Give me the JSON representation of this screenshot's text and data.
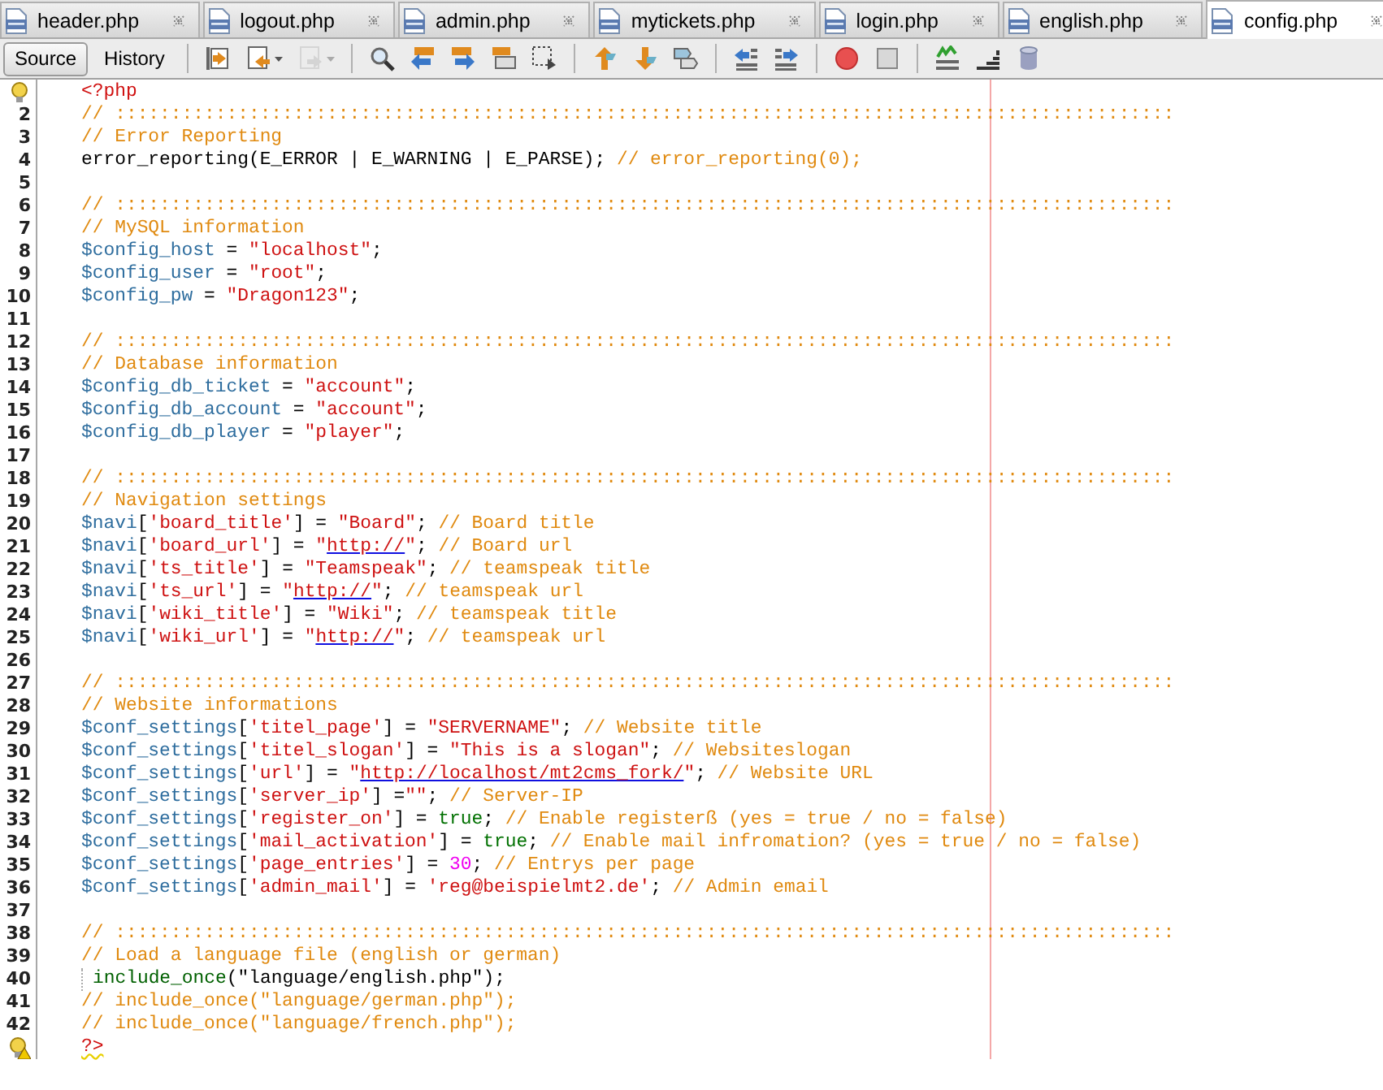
{
  "tabs": [
    {
      "label": "header.php",
      "selected": false
    },
    {
      "label": "logout.php",
      "selected": false
    },
    {
      "label": "admin.php",
      "selected": false
    },
    {
      "label": "mytickets.php",
      "selected": false
    },
    {
      "label": "login.php",
      "selected": false
    },
    {
      "label": "english.php",
      "selected": false
    },
    {
      "label": "config.php",
      "selected": true
    }
  ],
  "view_buttons": [
    {
      "label": "Source",
      "selected": true
    },
    {
      "label": "History",
      "selected": false
    }
  ],
  "toolbar": {
    "buttons": [
      {
        "disabled": false
      },
      {
        "disabled": false
      },
      {
        "disabled": true
      },
      {
        "disabled": false
      },
      {
        "disabled": false
      },
      {
        "disabled": false
      },
      {
        "disabled": false
      },
      {
        "disabled": false
      },
      {
        "disabled": false
      },
      {
        "disabled": false
      },
      {
        "disabled": false
      },
      {
        "disabled": false
      },
      {
        "disabled": false
      },
      {
        "disabled": false
      },
      {
        "disabled": false
      },
      {
        "disabled": false
      },
      {
        "disabled": false
      },
      {
        "disabled": false
      }
    ]
  },
  "editor": {
    "lines": [
      {
        "kind": "hint",
        "tokens": [
          {
            "kind": "tag",
            "text": "<?php"
          }
        ]
      },
      {
        "number": "2",
        "tokens": [
          {
            "kind": "comment",
            "text": "// :::::::::::::::::::::::::::::::::::::::::::::::::::::::::::::::::::::::::::::::::::::::::::::::"
          }
        ]
      },
      {
        "number": "3",
        "tokens": [
          {
            "kind": "comment",
            "text": "// Error Reporting"
          }
        ]
      },
      {
        "number": "4",
        "tokens": [
          {
            "kind": "plain",
            "text": "error_reporting(E_ERROR | E_WARNING | E_PARSE); "
          },
          {
            "kind": "comment",
            "text": "// error_reporting(0);"
          }
        ]
      },
      {
        "number": "5"
      },
      {
        "number": "6",
        "tokens": [
          {
            "kind": "comment",
            "text": "// :::::::::::::::::::::::::::::::::::::::::::::::::::::::::::::::::::::::::::::::::::::::::::::::"
          }
        ]
      },
      {
        "number": "7",
        "tokens": [
          {
            "kind": "comment",
            "text": "// MySQL information"
          }
        ]
      },
      {
        "number": "8",
        "tokens": [
          {
            "kind": "var",
            "text": "$config_host"
          },
          {
            "kind": "plain",
            "text": " = "
          },
          {
            "kind": "str",
            "text": "\"localhost\""
          },
          {
            "kind": "plain",
            "text": ";"
          }
        ]
      },
      {
        "number": "9",
        "tokens": [
          {
            "kind": "var",
            "text": "$config_user"
          },
          {
            "kind": "plain",
            "text": " = "
          },
          {
            "kind": "str",
            "text": "\"root\""
          },
          {
            "kind": "plain",
            "text": ";"
          }
        ]
      },
      {
        "number": "10",
        "tokens": [
          {
            "kind": "var",
            "text": "$config_pw"
          },
          {
            "kind": "plain",
            "text": " = "
          },
          {
            "kind": "str",
            "text": "\"Dragon123\""
          },
          {
            "kind": "plain",
            "text": ";"
          }
        ]
      },
      {
        "number": "11"
      },
      {
        "number": "12",
        "tokens": [
          {
            "kind": "comment",
            "text": "// :::::::::::::::::::::::::::::::::::::::::::::::::::::::::::::::::::::::::::::::::::::::::::::::"
          }
        ]
      },
      {
        "number": "13",
        "tokens": [
          {
            "kind": "comment",
            "text": "// Database information"
          }
        ]
      },
      {
        "number": "14",
        "tokens": [
          {
            "kind": "var",
            "text": "$config_db_ticket"
          },
          {
            "kind": "plain",
            "text": " = "
          },
          {
            "kind": "str",
            "text": "\"account\""
          },
          {
            "kind": "plain",
            "text": ";"
          }
        ]
      },
      {
        "number": "15",
        "tokens": [
          {
            "kind": "var",
            "text": "$config_db_account"
          },
          {
            "kind": "plain",
            "text": " = "
          },
          {
            "kind": "str",
            "text": "\"account\""
          },
          {
            "kind": "plain",
            "text": ";"
          }
        ]
      },
      {
        "number": "16",
        "tokens": [
          {
            "kind": "var",
            "text": "$config_db_player"
          },
          {
            "kind": "plain",
            "text": " = "
          },
          {
            "kind": "str",
            "text": "\"player\""
          },
          {
            "kind": "plain",
            "text": ";"
          }
        ]
      },
      {
        "number": "17"
      },
      {
        "number": "18",
        "tokens": [
          {
            "kind": "comment",
            "text": "// :::::::::::::::::::::::::::::::::::::::::::::::::::::::::::::::::::::::::::::::::::::::::::::::"
          }
        ]
      },
      {
        "number": "19",
        "tokens": [
          {
            "kind": "comment",
            "text": "// Navigation settings"
          }
        ]
      },
      {
        "number": "20",
        "tokens": [
          {
            "kind": "var",
            "text": "$navi"
          },
          {
            "kind": "plain",
            "text": "["
          },
          {
            "kind": "str",
            "text": "'board_title'"
          },
          {
            "kind": "plain",
            "text": "] = "
          },
          {
            "kind": "str",
            "text": "\"Board\""
          },
          {
            "kind": "plain",
            "text": "; "
          },
          {
            "kind": "comment",
            "text": "// Board title"
          }
        ]
      },
      {
        "number": "21",
        "tokens": [
          {
            "kind": "var",
            "text": "$navi"
          },
          {
            "kind": "plain",
            "text": "["
          },
          {
            "kind": "str",
            "text": "'board_url'"
          },
          {
            "kind": "plain",
            "text": "] = "
          },
          {
            "kind": "str",
            "text": "\""
          },
          {
            "kind": "url",
            "text": "http://"
          },
          {
            "kind": "str",
            "text": "\""
          },
          {
            "kind": "plain",
            "text": "; "
          },
          {
            "kind": "comment",
            "text": "// Board url"
          }
        ]
      },
      {
        "number": "22",
        "tokens": [
          {
            "kind": "var",
            "text": "$navi"
          },
          {
            "kind": "plain",
            "text": "["
          },
          {
            "kind": "str",
            "text": "'ts_title'"
          },
          {
            "kind": "plain",
            "text": "] = "
          },
          {
            "kind": "str",
            "text": "\"Teamspeak\""
          },
          {
            "kind": "plain",
            "text": "; "
          },
          {
            "kind": "comment",
            "text": "// teamspeak title"
          }
        ]
      },
      {
        "number": "23",
        "tokens": [
          {
            "kind": "var",
            "text": "$navi"
          },
          {
            "kind": "plain",
            "text": "["
          },
          {
            "kind": "str",
            "text": "'ts_url'"
          },
          {
            "kind": "plain",
            "text": "] = "
          },
          {
            "kind": "str",
            "text": "\""
          },
          {
            "kind": "url",
            "text": "http://"
          },
          {
            "kind": "str",
            "text": "\""
          },
          {
            "kind": "plain",
            "text": "; "
          },
          {
            "kind": "comment",
            "text": "// teamspeak url"
          }
        ]
      },
      {
        "number": "24",
        "tokens": [
          {
            "kind": "var",
            "text": "$navi"
          },
          {
            "kind": "plain",
            "text": "["
          },
          {
            "kind": "str",
            "text": "'wiki_title'"
          },
          {
            "kind": "plain",
            "text": "] = "
          },
          {
            "kind": "str",
            "text": "\"Wiki\""
          },
          {
            "kind": "plain",
            "text": "; "
          },
          {
            "kind": "comment",
            "text": "// teamspeak title"
          }
        ]
      },
      {
        "number": "25",
        "tokens": [
          {
            "kind": "var",
            "text": "$navi"
          },
          {
            "kind": "plain",
            "text": "["
          },
          {
            "kind": "str",
            "text": "'wiki_url'"
          },
          {
            "kind": "plain",
            "text": "] = "
          },
          {
            "kind": "str",
            "text": "\""
          },
          {
            "kind": "url",
            "text": "http://"
          },
          {
            "kind": "str",
            "text": "\""
          },
          {
            "kind": "plain",
            "text": "; "
          },
          {
            "kind": "comment",
            "text": "// teamspeak url"
          }
        ]
      },
      {
        "number": "26"
      },
      {
        "number": "27",
        "tokens": [
          {
            "kind": "comment",
            "text": "// :::::::::::::::::::::::::::::::::::::::::::::::::::::::::::::::::::::::::::::::::::::::::::::::"
          }
        ]
      },
      {
        "number": "28",
        "tokens": [
          {
            "kind": "comment",
            "text": "// Website informations"
          }
        ]
      },
      {
        "number": "29",
        "tokens": [
          {
            "kind": "var",
            "text": "$conf_settings"
          },
          {
            "kind": "plain",
            "text": "["
          },
          {
            "kind": "str",
            "text": "'titel_page'"
          },
          {
            "kind": "plain",
            "text": "] = "
          },
          {
            "kind": "str",
            "text": "\"SERVERNAME\""
          },
          {
            "kind": "plain",
            "text": "; "
          },
          {
            "kind": "comment",
            "text": "// Website title"
          }
        ]
      },
      {
        "number": "30",
        "tokens": [
          {
            "kind": "var",
            "text": "$conf_settings"
          },
          {
            "kind": "plain",
            "text": "["
          },
          {
            "kind": "str",
            "text": "'titel_slogan'"
          },
          {
            "kind": "plain",
            "text": "] = "
          },
          {
            "kind": "str",
            "text": "\"This is a slogan\""
          },
          {
            "kind": "plain",
            "text": "; "
          },
          {
            "kind": "comment",
            "text": "// Websiteslogan"
          }
        ]
      },
      {
        "number": "31",
        "tokens": [
          {
            "kind": "var",
            "text": "$conf_settings"
          },
          {
            "kind": "plain",
            "text": "["
          },
          {
            "kind": "str",
            "text": "'url'"
          },
          {
            "kind": "plain",
            "text": "] = "
          },
          {
            "kind": "str",
            "text": "\""
          },
          {
            "kind": "url",
            "text": "http://localhost/mt2cms_fork/"
          },
          {
            "kind": "str",
            "text": "\""
          },
          {
            "kind": "plain",
            "text": "; "
          },
          {
            "kind": "comment",
            "text": "// Website URL"
          }
        ]
      },
      {
        "number": "32",
        "tokens": [
          {
            "kind": "var",
            "text": "$conf_settings"
          },
          {
            "kind": "plain",
            "text": "["
          },
          {
            "kind": "str",
            "text": "'server_ip'"
          },
          {
            "kind": "plain",
            "text": "] ="
          },
          {
            "kind": "str",
            "text": "\"\""
          },
          {
            "kind": "plain",
            "text": "; "
          },
          {
            "kind": "comment",
            "text": "// Server-IP"
          }
        ]
      },
      {
        "number": "33",
        "tokens": [
          {
            "kind": "var",
            "text": "$conf_settings"
          },
          {
            "kind": "plain",
            "text": "["
          },
          {
            "kind": "str",
            "text": "'register_on'"
          },
          {
            "kind": "plain",
            "text": "] = "
          },
          {
            "kind": "kw",
            "text": "true"
          },
          {
            "kind": "plain",
            "text": "; "
          },
          {
            "kind": "comment",
            "text": "// Enable registerß (yes = true / no = false)"
          }
        ]
      },
      {
        "number": "34",
        "tokens": [
          {
            "kind": "var",
            "text": "$conf_settings"
          },
          {
            "kind": "plain",
            "text": "["
          },
          {
            "kind": "str",
            "text": "'mail_activation'"
          },
          {
            "kind": "plain",
            "text": "] = "
          },
          {
            "kind": "kw",
            "text": "true"
          },
          {
            "kind": "plain",
            "text": "; "
          },
          {
            "kind": "comment",
            "text": "// Enable mail infromation? (yes = true / no = false)"
          }
        ]
      },
      {
        "number": "35",
        "tokens": [
          {
            "kind": "var",
            "text": "$conf_settings"
          },
          {
            "kind": "plain",
            "text": "["
          },
          {
            "kind": "str",
            "text": "'page_entries'"
          },
          {
            "kind": "plain",
            "text": "] = "
          },
          {
            "kind": "num",
            "text": "30"
          },
          {
            "kind": "plain",
            "text": "; "
          },
          {
            "kind": "comment",
            "text": "// Entrys per page"
          }
        ]
      },
      {
        "number": "36",
        "tokens": [
          {
            "kind": "var",
            "text": "$conf_settings"
          },
          {
            "kind": "plain",
            "text": "["
          },
          {
            "kind": "str",
            "text": "'admin_mail'"
          },
          {
            "kind": "plain",
            "text": "] = "
          },
          {
            "kind": "str",
            "text": "'reg@beispielmt2.de'"
          },
          {
            "kind": "plain",
            "text": "; "
          },
          {
            "kind": "comment",
            "text": "// Admin email"
          }
        ]
      },
      {
        "number": "37"
      },
      {
        "number": "38",
        "tokens": [
          {
            "kind": "comment",
            "text": "// :::::::::::::::::::::::::::::::::::::::::::::::::::::::::::::::::::::::::::::::::::::::::::::::"
          }
        ]
      },
      {
        "number": "39",
        "tokens": [
          {
            "kind": "comment",
            "text": "// Load a language file (english or german)"
          }
        ]
      },
      {
        "number": "40",
        "indent_guide": true,
        "tokens": [
          {
            "kind": "func",
            "text": "include_once"
          },
          {
            "kind": "plain",
            "text": "(\"language/english.php\");"
          }
        ]
      },
      {
        "number": "41",
        "tokens": [
          {
            "kind": "comment",
            "text": "// include_once(\"language/german.php\");"
          }
        ]
      },
      {
        "number": "42",
        "tokens": [
          {
            "kind": "comment",
            "text": "// include_once(\"language/french.php\");"
          }
        ]
      },
      {
        "kind": "warning",
        "tokens": [
          {
            "kind": "tagwarn",
            "text": "?>"
          }
        ]
      }
    ]
  }
}
